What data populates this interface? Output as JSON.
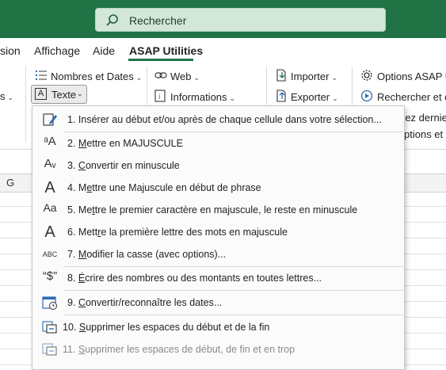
{
  "search": {
    "placeholder": "Rechercher"
  },
  "tabs": [
    {
      "label": "sion"
    },
    {
      "label": "Affichage"
    },
    {
      "label": "Aide"
    },
    {
      "label": "ASAP Utilities",
      "active": true
    }
  ],
  "ribbon": {
    "nombres_dates": "Nombres et Dates",
    "texte": "Texte",
    "web": "Web",
    "informations": "Informations",
    "importer": "Importer",
    "exporter": "Exporter",
    "options_asap": "Options ASAP Ut",
    "rechercher_et": "Rechercher et d",
    "ez_dernie": "rez dernie",
    "ptions_et": "ptions et",
    "left_cut": "s"
  },
  "sheet": {
    "column_label": "G"
  },
  "menu": {
    "items": [
      {
        "num": "1.",
        "text": "Insérer au début et/ou après de chaque cellule dans votre sélection...",
        "icon": "insert-text-icon"
      },
      {
        "num": "2.",
        "pre": "",
        "ul": "M",
        "post": "ettre en MAJUSCULE",
        "icon": "uppercase-icon"
      },
      {
        "num": "3.",
        "pre": "",
        "ul": "C",
        "post": "onvertir en minuscule",
        "icon": "lowercase-icon"
      },
      {
        "num": "4.",
        "pre": "M",
        "ul": "e",
        "post": "ttre une Majuscule en début de phrase",
        "icon": "sentence-case-icon"
      },
      {
        "num": "5.",
        "pre": "Me",
        "ul": "t",
        "post": "tre le premier caractère en majuscule, le reste en minuscule",
        "icon": "first-char-upper-icon"
      },
      {
        "num": "6.",
        "pre": "Mett",
        "ul": "r",
        "post": "e la première lettre des mots en majuscule",
        "icon": "title-case-icon"
      },
      {
        "num": "7.",
        "pre": "",
        "ul": "M",
        "post": "odifier la casse (avec options)...",
        "icon": "change-case-icon"
      },
      {
        "num": "8.",
        "pre": "",
        "ul": "É",
        "post": "crire des nombres ou des montants en toutes lettres...",
        "icon": "spell-number-icon"
      },
      {
        "num": "9.",
        "pre": "",
        "ul": "C",
        "post": "onvertir/reconnaître les dates...",
        "icon": "calendar-icon"
      },
      {
        "num": "10.",
        "pre": "",
        "ul": "S",
        "post": "upprimer les espaces du début et de la fin",
        "icon": "trim-spaces-icon"
      },
      {
        "num": "11.",
        "pre": "",
        "ul": "S",
        "post": "upprimer les espaces de début, de fin et en trop",
        "icon": "trim-extra-spaces-icon"
      }
    ]
  }
}
